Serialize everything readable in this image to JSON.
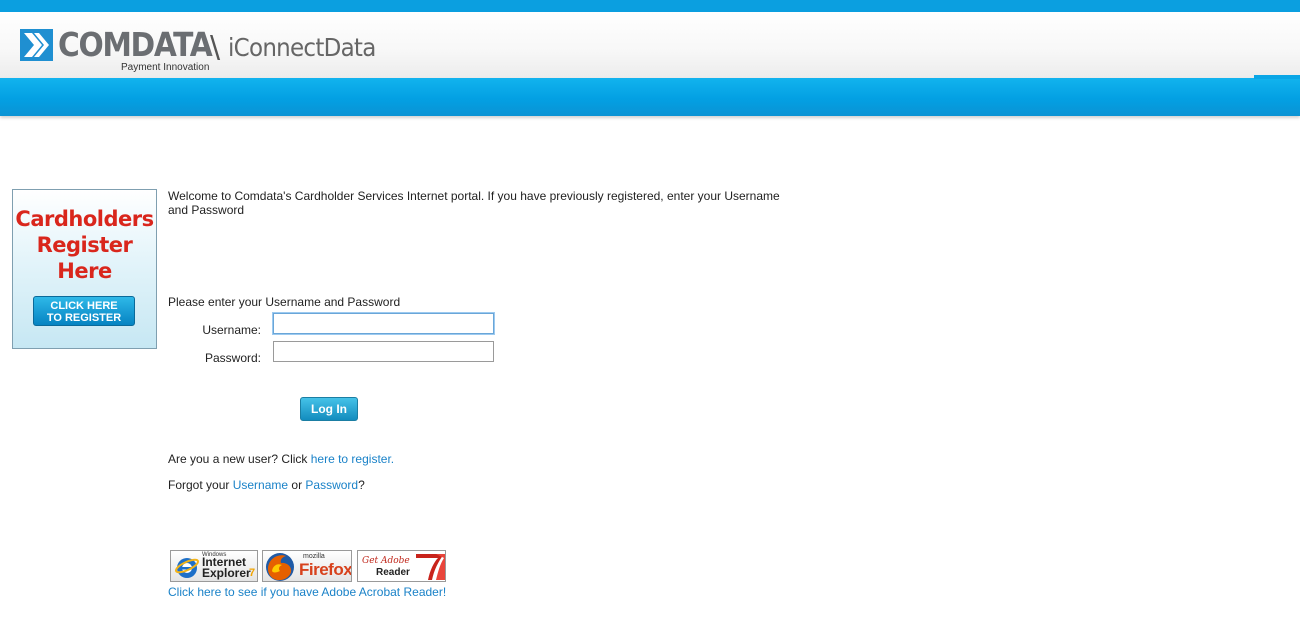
{
  "header": {
    "brand": "COMDATA",
    "tagline": "Payment Innovation",
    "separator": "\\",
    "product": "iConnectData"
  },
  "promo": {
    "title_line1": "Cardholders",
    "title_line2": "Register",
    "title_line3": "Here",
    "button_line1": "CLICK HERE",
    "button_line2": "TO REGISTER"
  },
  "main": {
    "welcome": "Welcome to Comdata's Cardholder Services Internet portal. If you have previously registered, enter your Username and Password",
    "prompt": "Please enter your Username and Password",
    "username_label": "Username:",
    "password_label": "Password:",
    "username_value": "",
    "password_value": "",
    "login_label": "Log In",
    "new_user_text": "Are you a new user? Click ",
    "new_user_link": "here to register.",
    "forgot_prefix": "Forgot your ",
    "forgot_username": "Username",
    "forgot_or": " or ",
    "forgot_password": "Password",
    "forgot_suffix": "?"
  },
  "badges": {
    "ie_small": "Windows",
    "ie_line1": "Internet",
    "ie_line2": "Explorer",
    "ie_version": "7",
    "ff_small": "mozilla",
    "ff_name": "Firefox",
    "ar_line1": "Get Adobe",
    "ar_line2": "Reader"
  },
  "adobe_link": "Click here to see if you have Adobe Acrobat Reader!",
  "colors": {
    "accent_blue": "#03a0e3",
    "link": "#1a82c8",
    "promo_red": "#d9261c"
  }
}
